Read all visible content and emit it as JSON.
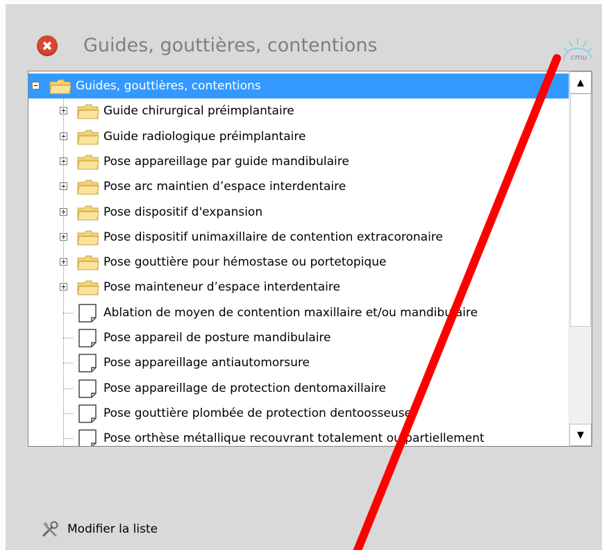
{
  "header": {
    "title": "Guides, gouttières, contentions",
    "logo_text": "cmu"
  },
  "tree": {
    "rows": [
      {
        "label": "Guides, gouttières, contentions",
        "kind": "folder",
        "level": 0,
        "expander": "minus",
        "selected": true
      },
      {
        "label": "Guide chirurgical préimplantaire",
        "kind": "folder",
        "level": 1,
        "expander": "plus",
        "selected": false
      },
      {
        "label": "Guide radiologique préimplantaire",
        "kind": "folder",
        "level": 1,
        "expander": "plus",
        "selected": false
      },
      {
        "label": "Pose appareillage par guide mandibulaire",
        "kind": "folder",
        "level": 1,
        "expander": "plus",
        "selected": false
      },
      {
        "label": "Pose arc maintien d’espace interdentaire",
        "kind": "folder",
        "level": 1,
        "expander": "plus",
        "selected": false
      },
      {
        "label": "Pose dispositif d'expansion",
        "kind": "folder",
        "level": 1,
        "expander": "plus",
        "selected": false
      },
      {
        "label": "Pose dispositif unimaxillaire de contention extracoronaire",
        "kind": "folder",
        "level": 1,
        "expander": "plus",
        "selected": false
      },
      {
        "label": "Pose gouttière pour hémostase ou portetopique",
        "kind": "folder",
        "level": 1,
        "expander": "plus",
        "selected": false
      },
      {
        "label": "Pose mainteneur d’espace interdentaire",
        "kind": "folder",
        "level": 1,
        "expander": "plus",
        "selected": false
      },
      {
        "label": "Ablation de moyen de contention maxillaire et/ou mandibulaire",
        "kind": "doc",
        "level": 1,
        "expander": "none",
        "selected": false
      },
      {
        "label": "Pose appareil de posture mandibulaire",
        "kind": "doc",
        "level": 1,
        "expander": "none",
        "selected": false
      },
      {
        "label": "Pose appareillage antiautomorsure",
        "kind": "doc",
        "level": 1,
        "expander": "none",
        "selected": false
      },
      {
        "label": "Pose appareillage de protection dentomaxillaire",
        "kind": "doc",
        "level": 1,
        "expander": "none",
        "selected": false
      },
      {
        "label": "Pose gouttière plombée de protection dentoosseuse",
        "kind": "doc",
        "level": 1,
        "expander": "none",
        "selected": false
      },
      {
        "label": "Pose orthèse métallique recouvrant totalement ou partiellement",
        "kind": "doc",
        "level": 1,
        "expander": "none",
        "selected": false
      }
    ],
    "scroll": {
      "up_icon": "▲",
      "down_icon": "▼",
      "position": 0.0
    }
  },
  "footer": {
    "modify_label": "Modifier la liste"
  },
  "colors": {
    "selection": "#3399ff",
    "close_icon": "#d9472f",
    "annotation_line": "#ff0000"
  },
  "icons": {
    "close": "close-icon",
    "folder": "folder-icon",
    "document": "document-icon",
    "tools": "tools-icon",
    "logo": "cmu-logo"
  }
}
